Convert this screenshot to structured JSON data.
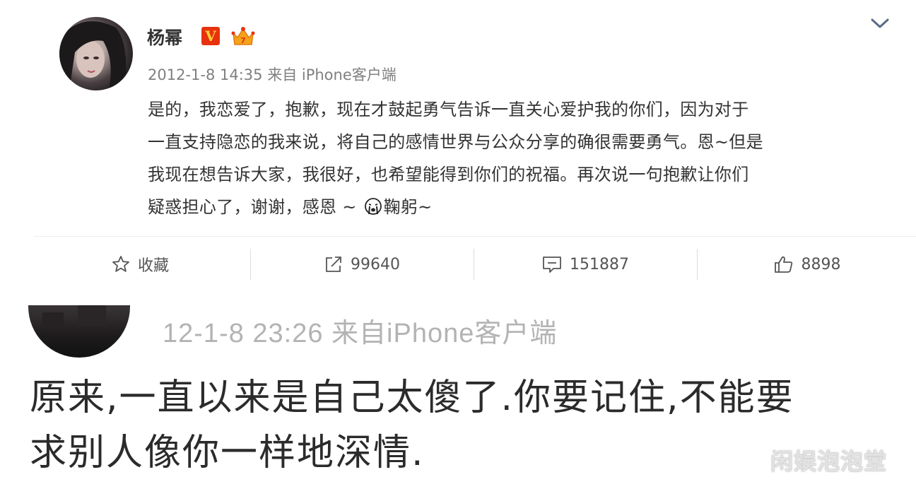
{
  "post": {
    "username": "杨幂",
    "verified_badge": "V",
    "meta": "2012-1-8 14:35 来自 iPhone客户端",
    "content_lines": [
      "是的，我恋爱了，抱歉，现在才鼓起勇气告诉一直关心爱护我的你们，因为对于",
      "一直支持隐恋的我来说，将自己的感情世界与公众分享的确很需要勇气。恩~但是",
      "我现在想告诉大家，我很好，也希望能得到你们的祝福。再次说一句抱歉让你们"
    ],
    "content_last_before_emoji": "疑惑担心了，谢谢，感恩 ~ ",
    "content_last_after_emoji": "鞠躬~",
    "actions": {
      "favorite_label": "收藏",
      "repost_count": "99640",
      "comment_count": "151887",
      "like_count": "8898"
    }
  },
  "comment": {
    "meta": "12-1-8 23:26  来自iPhone客户端",
    "text_lines": [
      "原来,一直以来是自己太傻了.你要记住,不能要",
      "求别人像你一样地深情."
    ]
  },
  "watermark": "闲娱泡泡堂",
  "icons": {
    "expand": "chevron-down-icon",
    "favorite": "star-icon",
    "repost": "share-icon",
    "comment": "comment-icon",
    "like": "thumbs-up-icon",
    "emoji": "crying-emoji-icon",
    "member": "crown-icon"
  },
  "colors": {
    "verified_red": "#e8320f",
    "verified_yellow": "#ffd23a",
    "meta_gray": "#808080",
    "text": "#333333"
  }
}
